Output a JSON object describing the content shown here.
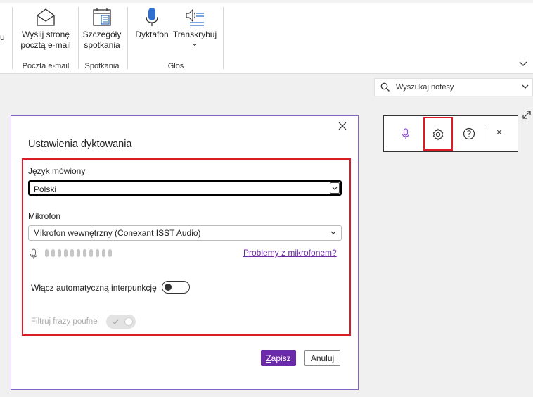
{
  "ribbon": {
    "stub_label": "u",
    "groups": [
      {
        "label": "Poczta e-mail",
        "buttons": [
          {
            "line1": "Wyślij stronę",
            "line2": "pocztą e-mail",
            "icon": "envelope-icon"
          }
        ]
      },
      {
        "label": "Spotkania",
        "buttons": [
          {
            "line1": "Szczegóły",
            "line2": "spotkania",
            "icon": "calendar-icon"
          }
        ]
      },
      {
        "label": "Głos",
        "buttons": [
          {
            "line1": "Dyktafon",
            "line2": "",
            "icon": "microphone-icon"
          },
          {
            "line1": "Transkrybuj",
            "line2": "⌄",
            "icon": "transcribe-icon"
          }
        ]
      }
    ],
    "collapse_icon": "chevron-down-icon"
  },
  "search": {
    "placeholder": "Wyszukaj notesy"
  },
  "dialog": {
    "title": "Ustawienia dyktowania",
    "spoken_language_label": "Język mówiony",
    "spoken_language_value": "Polski",
    "microphone_label": "Mikrofon",
    "microphone_value": "Mikrofon wewnętrzny (Conexant ISST Audio)",
    "mic_problems_link": "Problemy z mikrofonem?",
    "auto_punctuation_label": "Włącz automatyczną interpunkcję",
    "auto_punctuation_on": false,
    "filter_phrases_label": "Filtruj frazy poufne",
    "filter_phrases_on": true,
    "save_hotkey": "Z",
    "save_rest": "apisz",
    "cancel_label": "Anuluj"
  },
  "dictation_toolbar": {
    "icons": [
      "microphone-icon",
      "gear-icon",
      "help-icon",
      "close-icon"
    ],
    "close_label": "×"
  },
  "colors": {
    "accent": "#6b2ba8",
    "highlight": "#d91c26"
  }
}
